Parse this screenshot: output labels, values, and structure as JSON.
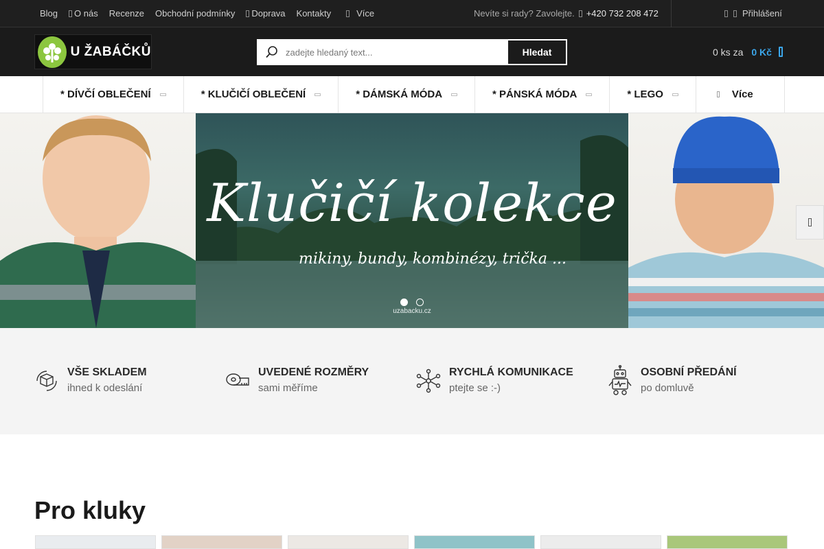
{
  "topbar": {
    "links": [
      "Blog",
      "O nás",
      "Recenze",
      "Obchodní podmínky",
      "Doprava",
      "Kontakty"
    ],
    "more_label": "Více",
    "help_text": "Nevíte si rady? Zavolejte.",
    "phone": "+420 732 208 472",
    "login_label": "Přihlášení"
  },
  "header": {
    "logo_text": "U ŽABÁČKŮ",
    "search_placeholder": "zadejte hledaný text...",
    "search_button": "Hledat",
    "cart_count": "0 ks za",
    "cart_price": "0 Kč"
  },
  "menu": {
    "categories": [
      "* DÍVČÍ OBLEČENÍ",
      "* KLUČIČÍ OBLEČENÍ",
      "* DÁMSKÁ MÓDA",
      "* PÁNSKÁ MÓDA",
      "* LEGO"
    ],
    "more_label": "Více"
  },
  "hero": {
    "title": "Klučičí kolekce",
    "subtitle": "mikiny, bundy, kombinézy, trička ...",
    "site": "uzabacku.cz",
    "slide_count": 2,
    "active_slide": 1
  },
  "benefits": [
    {
      "title": "VŠE SKLADEM",
      "subtitle": "ihned k odeslání",
      "icon": "box-icon"
    },
    {
      "title": "UVEDENÉ ROZMĚRY",
      "subtitle": "sami měříme",
      "icon": "measuring-tape-icon"
    },
    {
      "title": "RYCHLÁ KOMUNIKACE",
      "subtitle": "ptejte se :-)",
      "icon": "network-icon"
    },
    {
      "title": "OSOBNÍ PŘEDÁNÍ",
      "subtitle": "po domluvě",
      "icon": "robot-icon"
    }
  ],
  "section": {
    "title": "Pro kluky"
  },
  "colors": {
    "topbar_bg": "#1f1f1f",
    "header_bg": "#1b1b1b",
    "logo_green": "#8cc63f",
    "accent_blue": "#3ba6ea",
    "benefits_bg": "#f4f4f4"
  }
}
